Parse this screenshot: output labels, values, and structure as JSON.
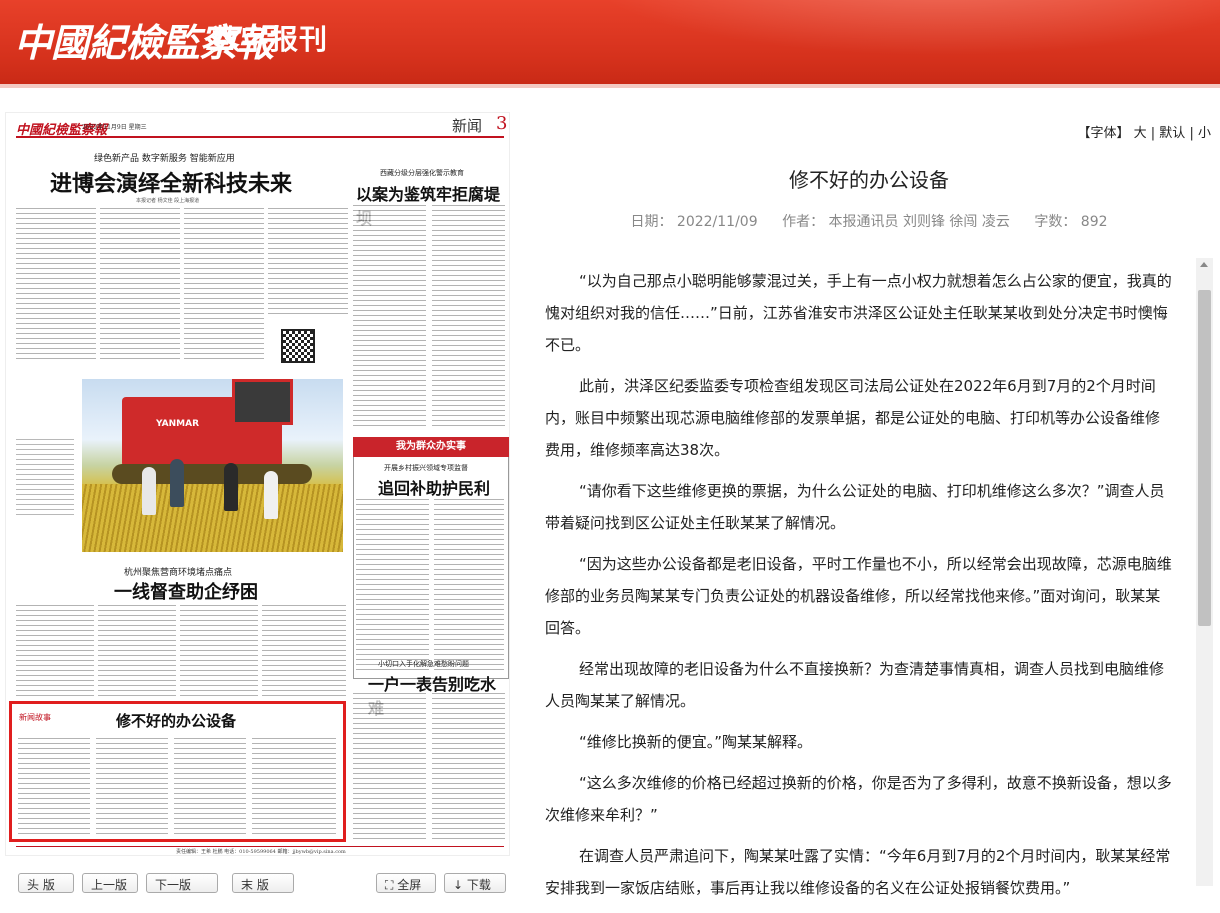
{
  "header": {
    "logo": "中國紀檢監察報",
    "subtitle": "数字报刊"
  },
  "paper": {
    "masthead": "中國紀檢監察報",
    "date_line": "2022年11月9日  星期三",
    "section": "新闻",
    "page_number": "3",
    "story1": {
      "kicker": "绿色新产品 数字新服务 智能新应用",
      "title": "进博会演绎全新科技未来",
      "byline": "本报记者 杨文佳 段上海报道"
    },
    "story2": {
      "kicker": "西藏分级分层强化警示教育",
      "title": "以案为鉴筑牢拒腐堤坝"
    },
    "photo_brand": "YANMAR",
    "story3": {
      "kicker": "杭州聚焦营商环境堵点痛点",
      "title": "一线督查助企纾困"
    },
    "box": {
      "label": "我为群众办实事",
      "kicker": "开展乡村振兴领域专项监督",
      "title": "追回补助护民利"
    },
    "story4": {
      "kicker": "小切口入手化解急难愁盼问题",
      "title": "一户一表告别吃水难"
    },
    "story5": {
      "tag": "新闻故事",
      "title": "修不好的办公设备"
    },
    "footer": "责任编辑：王希  杜鹏  电话：010-59599064  邮箱：jjbywb@vip.sina.com"
  },
  "nav": {
    "first": "头 版",
    "prev": "上一版",
    "next": "下一版",
    "last": "末 版",
    "full": "全屏",
    "download": "下载"
  },
  "fontbar": {
    "label": "【字体】",
    "large": "大",
    "default": "默认",
    "small": "小",
    "sep": "|"
  },
  "article": {
    "title": "修不好的办公设备",
    "date": "日期：  2022/11/09",
    "author": "作者：  本报通讯员 刘则锋 徐闯 凌云",
    "wordcount": "字数：  892",
    "paragraphs": [
      "“以为自己那点小聪明能够蒙混过关，手上有一点小权力就想着怎么占公家的便宜，我真的愧对组织对我的信任……”日前，江苏省淮安市洪泽区公证处主任耿某某收到处分决定书时懊悔不已。",
      "此前，洪泽区纪委监委专项检查组发现区司法局公证处在2022年6月到7月的2个月时间内，账目中频繁出现芯源电脑维修部的发票单据，都是公证处的电脑、打印机等办公设备维修费用，维修频率高达38次。",
      "“请你看下这些维修更换的票据，为什么公证处的电脑、打印机维修这么多次？”调查人员带着疑问找到区公证处主任耿某某了解情况。",
      "“因为这些办公设备都是老旧设备，平时工作量也不小，所以经常会出现故障，芯源电脑维修部的业务员陶某某专门负责公证处的机器设备维修，所以经常找他来修。”面对询问，耿某某回答。",
      "经常出现故障的老旧设备为什么不直接换新？为查清楚事情真相，调查人员找到电脑维修人员陶某某了解情况。",
      "“维修比换新的便宜。”陶某某解释。",
      "“这么多次维修的价格已经超过换新的价格，你是否为了多得利，故意不换新设备，想以多次维修来牟利？”",
      "在调查人员严肃追问下，陶某某吐露了实情：“今年6月到7月的2个月时间内，耿某某经常安排我到一家饭店结账，事后再让我以维修设备的名义在公证处报销餐饮费用。”"
    ]
  }
}
